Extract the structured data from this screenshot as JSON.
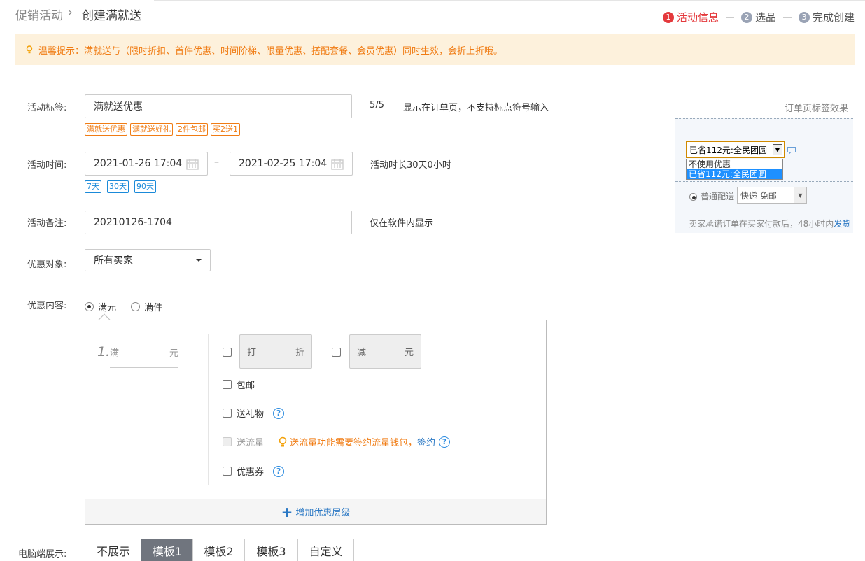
{
  "breadcrumb": {
    "parent": "促销活动",
    "separator": "›",
    "current": "创建满就送"
  },
  "steps": [
    {
      "num": "1",
      "label": "活动信息"
    },
    {
      "num": "2",
      "label": "选品"
    },
    {
      "num": "3",
      "label": "完成创建"
    }
  ],
  "tip": "温馨提示：满就送与（限时折扣、首件优惠、时间阶梯、限量优惠、搭配套餐、会员优惠）同时生效，会折上折哦。",
  "tag_field": {
    "label": "活动标签:",
    "value": "满就送优惠",
    "count": "5/5",
    "hint": "显示在订单页，不支持标点符号输入",
    "quick_tags": [
      "满就送优惠",
      "满就送好礼",
      "2件包邮",
      "买2送1"
    ]
  },
  "time_field": {
    "label": "活动时间:",
    "start": "2021-01-26 17:04",
    "end": "2021-02-25 17:04",
    "dash": "–",
    "duration": "活动时长30天0小时",
    "quick": [
      "7天",
      "30天",
      "90天"
    ]
  },
  "remark_field": {
    "label": "活动备注:",
    "value": "20210126-1704",
    "hint": "仅在软件内显示"
  },
  "target_field": {
    "label": "优惠对象:",
    "value": "所有买家"
  },
  "content_field": {
    "label": "优惠内容:",
    "options": [
      "满元",
      "满件"
    ],
    "tier_no": "1.",
    "tier_prefix": "满",
    "tier_unit": "元",
    "discount_prefix": "打",
    "discount_unit": "折",
    "reduce_prefix": "减",
    "reduce_unit": "元",
    "free_shipping": "包邮",
    "gift": "送礼物",
    "traffic": "送流量",
    "traffic_hint": "送流量功能需要签约流量钱包，",
    "sign_link": "签约",
    "coupon": "优惠券",
    "add_level": "增加优惠层级"
  },
  "pc_display": {
    "label": "电脑端展示:",
    "options": [
      "不展示",
      "模板1",
      "模板2",
      "模板3",
      "自定义"
    ],
    "selected": "模板1"
  },
  "preview": {
    "title": "订单页标签效果",
    "select_value": "已省112元:全民团圆",
    "options": [
      "不使用优惠",
      "已省112元:全民团圆"
    ],
    "delivery_label": "普通配送",
    "delivery_value": "快递 免邮",
    "promise": "卖家承诺订单在买家付款后，48小时内",
    "promise_link": "发货"
  },
  "colors": {
    "accent_red": "#e4393c",
    "warning_orange": "#f07c14",
    "link_blue": "#2a78c4",
    "selected_seg": "#70757e"
  }
}
